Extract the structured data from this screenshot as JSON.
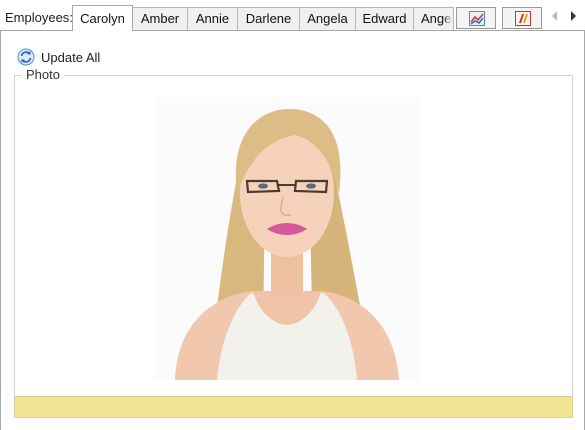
{
  "header": {
    "employees_label": "Employees:",
    "tabs": [
      {
        "label": "Carolyn",
        "active": true
      },
      {
        "label": "Amber",
        "active": false
      },
      {
        "label": "Annie",
        "active": false
      },
      {
        "label": "Darlene",
        "active": false
      },
      {
        "label": "Angela",
        "active": false
      },
      {
        "label": "Edward",
        "active": false
      },
      {
        "label": "Ange",
        "active": false
      }
    ],
    "toolbar_icons": [
      "chart-icon",
      "report-icon"
    ],
    "nav_icons": [
      "scroll-left-icon",
      "scroll-right-icon"
    ]
  },
  "panel": {
    "update_all_label": "Update All",
    "photo_group_label": "Photo",
    "status_bar_color": "#f1e594"
  }
}
